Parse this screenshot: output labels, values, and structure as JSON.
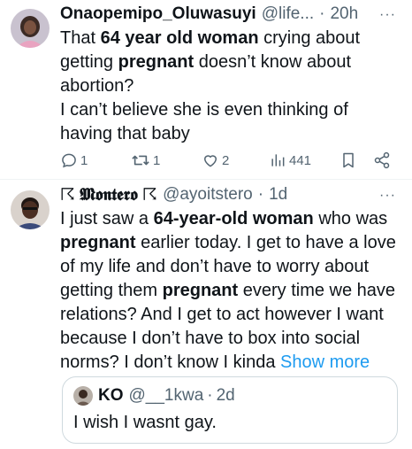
{
  "tweet1": {
    "display_name": "Onaopemipo_Oluwasuyi",
    "handle": "@life...",
    "separator": "·",
    "time": "20h",
    "more": "···",
    "body": [
      {
        "text": "That "
      },
      {
        "text": "64 year old woman",
        "bold": true
      },
      {
        "text": " crying about getting "
      },
      {
        "text": "pregnant",
        "bold": true
      },
      {
        "text": " doesn’t know about abortion?"
      },
      {
        "br": true
      },
      {
        "text": "I can’t believe she is even thinking of having that baby"
      }
    ],
    "actions": {
      "replies": "1",
      "reposts": "1",
      "likes": "2",
      "views": "441"
    }
  },
  "tweet2": {
    "display_name": "☈ 𝕸𝖔𝖓𝖙𝖊𝖗𝖔 ☈",
    "handle": "@ayoitstero",
    "separator": "·",
    "time": "1d",
    "more": "···",
    "body": [
      {
        "text": "I just saw a "
      },
      {
        "text": "64-year-old woman",
        "bold": true
      },
      {
        "text": " who was "
      },
      {
        "text": "pregnant",
        "bold": true
      },
      {
        "text": " earlier today. I get to have a love of my life and don’t have to worry about getting them "
      },
      {
        "text": "pregnant",
        "bold": true
      },
      {
        "text": " every time we have relations? And I get to act however I want because I don’t have to box into social norms? I don’t know I kinda "
      }
    ],
    "show_more": "Show more",
    "quote": {
      "display_name": "KO",
      "handle": "@__1kwa",
      "separator": "·",
      "time": "2d",
      "text": "I wish I wasnt gay."
    }
  },
  "colors": {
    "text": "#0f1419",
    "secondary": "#536471",
    "link": "#1d9bf0",
    "border": "#cfd9de"
  },
  "icons": [
    "reply-icon",
    "repost-icon",
    "like-icon",
    "views-icon",
    "bookmark-icon",
    "share-icon"
  ]
}
